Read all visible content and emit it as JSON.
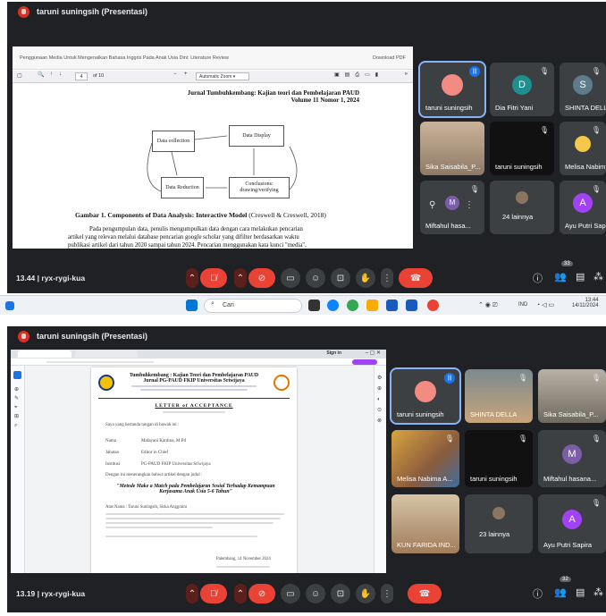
{
  "shot1": {
    "presenter_title": "taruni suningsih (Presentasi)",
    "doc_title": "Penggunaan Media Untuk Mengenalkan Bahasa Inggris Pada Anak Usia Dini: Literature Review",
    "download": "Download PDF",
    "page_current": "4",
    "page_total": "of 10",
    "zoom": "Automatic Zoom",
    "journal_line1": "Jurnal Tumbuhkembang: Kajian teori dan Pembelajaran PAUD",
    "journal_line2": "Volume 11 Nomor 1, 2024",
    "diagram": {
      "data_collection": "Data collection",
      "data_display": "Data Display",
      "data_reduction": "Data Reduction",
      "conclusions": "Conclusions: drawing/verifying"
    },
    "caption_bold": "Gambar 1. Components of Data Analysis: Interactive Model",
    "caption_rest": " (Creswell & Creswell, 2018)",
    "para_l1": "Pada pengumpulan data, penulis mengumpulkan data dengan cara melakukan pencarian",
    "para_l2": "artikel yang relevan melalui database pencarian google scholar yang difilter berdasarkan waktu",
    "para_l3": "publikasi artikel dari tahun 2020 sampai tahun 2024. Pencarian menggunakan kata kunci \"media\",",
    "tiles": [
      {
        "name": "taruni suningsih"
      },
      {
        "name": "Dia Fitri Yani",
        "letter": "D"
      },
      {
        "name": "SHINTA DELLA",
        "letter": "S"
      },
      {
        "name": "Sika Saisabila_P..."
      },
      {
        "name": "taruni suningsih"
      },
      {
        "name": "Melisa Nabim..."
      },
      {
        "name": "Miftahul hasa..."
      },
      {
        "name": "24 lainnya"
      },
      {
        "name": "Ayu Putri Sapira",
        "letter": "A"
      }
    ],
    "meeting_time": "13.44",
    "meeting_code": "ryx-rygi-kua",
    "people_count": "33",
    "taskbar_search": "Cari",
    "tray_lang": "IND",
    "tray_time": "13:44",
    "tray_date": "14/11/2024",
    "colors": {
      "meet_bg": "#202124",
      "tile_bg": "#3c4043",
      "end_call": "#ea4335",
      "accent": "#1a73e8"
    }
  },
  "shot2": {
    "presenter_title": "taruni suningsih (Presentasi)",
    "sign_in": "Sign in",
    "loa_journal_l1": "Tumbuhkembang : Kajian Teori dan Pembelajaran PAUD",
    "loa_journal_l2": "Jurnal PG-PAUD FKIP Universitas Sriwijaya",
    "loa_title": "LETTER of ACCEPTANCE",
    "intro": "Saya yang bertanda tangan di bawah ini :",
    "rows": [
      {
        "k": "Nama",
        "v": "Mafayani Kardina, M.Pd"
      },
      {
        "k": "Jabatan",
        "v": "Editor in Chief"
      },
      {
        "k": "Institusi",
        "v": "PG-PAUD FKIP Universitas Sriwijaya"
      }
    ],
    "statement": "Dengan ini menerangkan bahwa artikel dengan judul :",
    "article_title": "\"Metode Make a Match pada Pembelajaran Sosial Terhadap Kemampuan Kerjasama Anak Usia 5-6 Tahun\"",
    "author_label": "Atas Nama : Taruni Suningsih, Siska Anggraini",
    "date_line": "Palembang, 14 November 2024",
    "tiles": [
      {
        "name": "taruni suningsih"
      },
      {
        "name": "SHINTA DELLA"
      },
      {
        "name": "Sika Saisabila_P..."
      },
      {
        "name": "Melisa Nabima A..."
      },
      {
        "name": "taruni suningsih"
      },
      {
        "name": "Miftahul hasana...",
        "letter": "M"
      },
      {
        "name": "KUN FARIDA IND..."
      },
      {
        "name": "23 lainnya"
      },
      {
        "name": "Ayu Putri Sapira",
        "letter": "A"
      }
    ],
    "meeting_time": "13.19",
    "meeting_code": "ryx-rygi-kua",
    "people_count": "32"
  }
}
